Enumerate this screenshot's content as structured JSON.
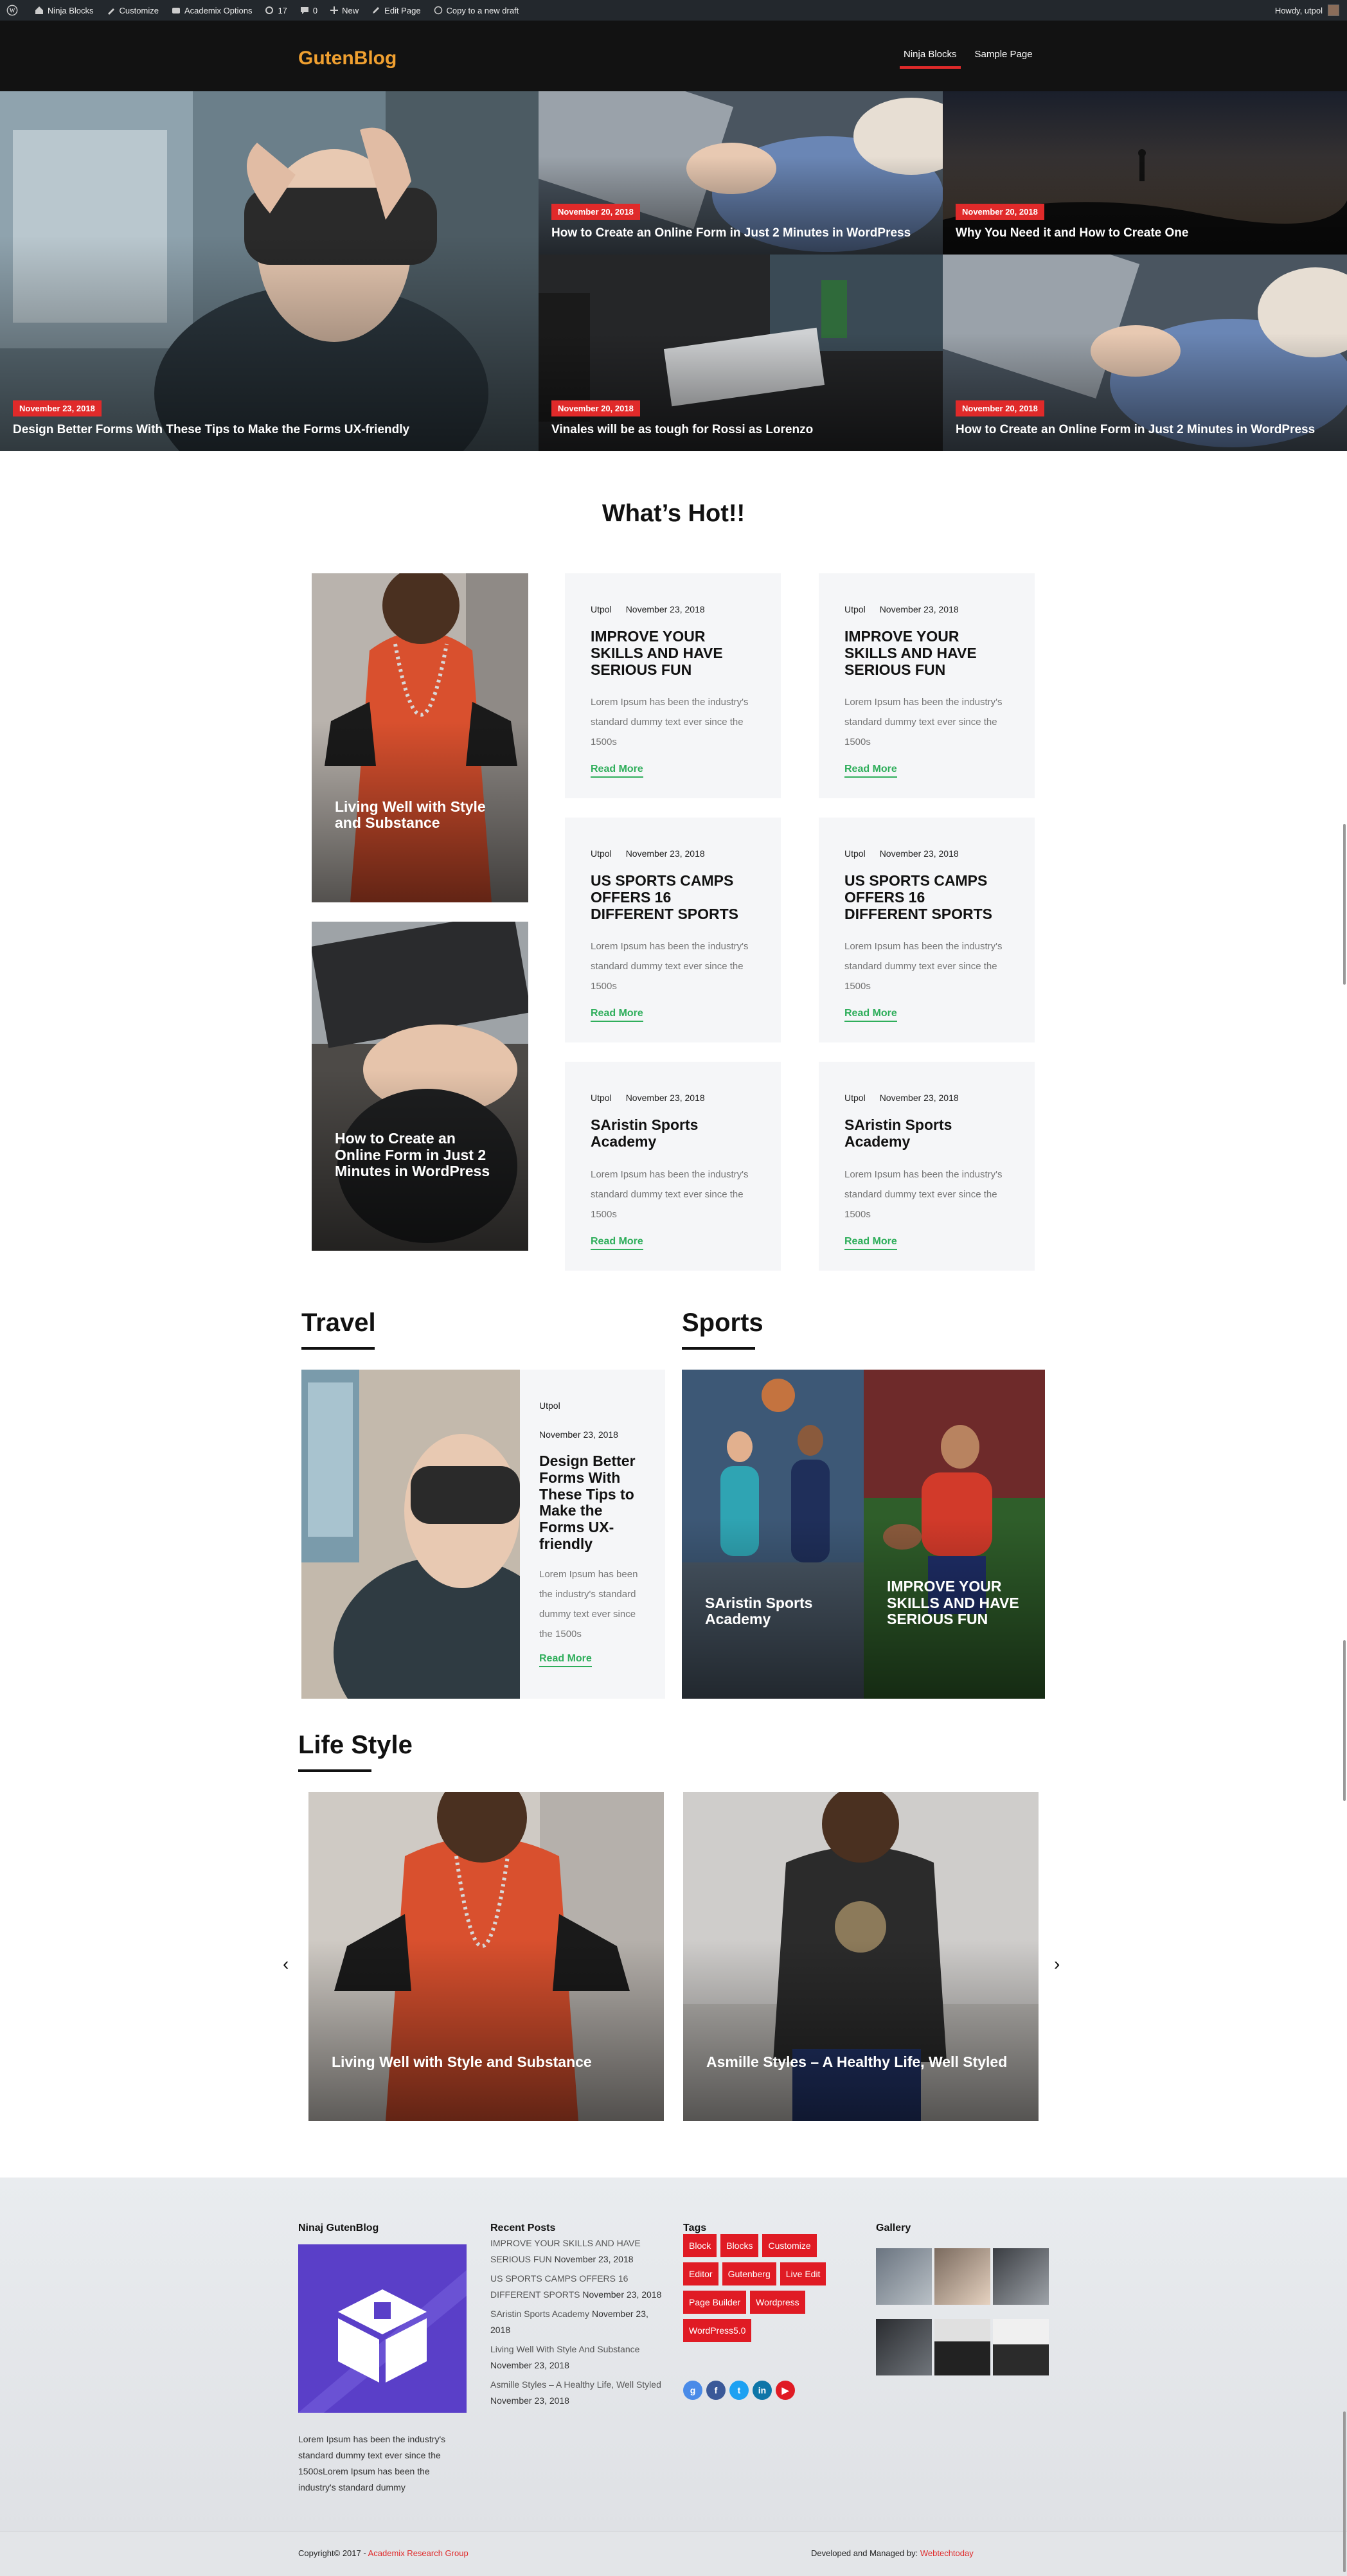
{
  "adminbar": {
    "site": "Ninja Blocks",
    "customize": "Customize",
    "academix": "Academix Options",
    "updates": "17",
    "comments": "0",
    "new": "New",
    "edit_page": "Edit Page",
    "copy_draft": "Copy to a new draft",
    "howdy": "Howdy, utpol"
  },
  "header": {
    "logo": "GutenBlog",
    "nav": [
      "Ninja Blocks",
      "Sample Page"
    ]
  },
  "hero": [
    {
      "date": "November 23, 2018",
      "title": "Design Better Forms With These Tips to Make the Forms UX-friendly"
    },
    {
      "date": "November 20, 2018",
      "title": "How to Create an Online Form in Just 2 Minutes in WordPress"
    },
    {
      "date": "November 20, 2018",
      "title": "Why You Need it and How to Create One"
    },
    {
      "date": "November 20, 2018",
      "title": "Vinales will be as tough for Rossi as Lorenzo"
    },
    {
      "date": "November 20, 2018",
      "title": "How to Create an Online Form in Just 2 Minutes in WordPress"
    }
  ],
  "whats_hot": {
    "heading": "What’s Hot!!",
    "image_cards": [
      {
        "title": "Living Well with Style and Substance"
      },
      {
        "title": "How to Create an Online Form in Just 2 Minutes in WordPress"
      }
    ],
    "posts": [
      {
        "author": "Utpol",
        "date": "November 23, 2018",
        "title": "IMPROVE YOUR SKILLS AND HAVE SERIOUS FUN",
        "excerpt": "Lorem Ipsum has been the industry's standard dummy text ever since the 1500s",
        "read_more": "Read More"
      },
      {
        "author": "Utpol",
        "date": "November 23, 2018",
        "title": "IMPROVE YOUR SKILLS AND HAVE SERIOUS FUN",
        "excerpt": "Lorem Ipsum has been the industry's standard dummy text ever since the 1500s",
        "read_more": "Read More"
      },
      {
        "author": "Utpol",
        "date": "November 23, 2018",
        "title": "US SPORTS CAMPS OFFERS 16 DIFFERENT SPORTS",
        "excerpt": "Lorem Ipsum has been the industry's standard dummy text ever since the 1500s",
        "read_more": "Read More"
      },
      {
        "author": "Utpol",
        "date": "November 23, 2018",
        "title": "US SPORTS CAMPS OFFERS 16 DIFFERENT SPORTS",
        "excerpt": "Lorem Ipsum has been the industry's standard dummy text ever since the 1500s",
        "read_more": "Read More"
      },
      {
        "author": "Utpol",
        "date": "November 23, 2018",
        "title": "SAristin Sports Academy",
        "excerpt": "Lorem Ipsum has been the industry's standard dummy text ever since the 1500s",
        "read_more": "Read More"
      },
      {
        "author": "Utpol",
        "date": "November 23, 2018",
        "title": "SAristin Sports Academy",
        "excerpt": "Lorem Ipsum has been the industry's standard dummy text ever since the 1500s",
        "read_more": "Read More"
      }
    ]
  },
  "travel": {
    "heading": "Travel",
    "author": "Utpol",
    "date": "November 23, 2018",
    "title": "Design Better Forms With These Tips to Make the Forms UX-friendly",
    "excerpt": "Lorem Ipsum has been the industry's standard dummy text ever since the 1500s",
    "read_more": "Read More"
  },
  "sports": {
    "heading": "Sports",
    "cards": [
      "SAristin Sports Academy",
      "IMPROVE YOUR SKILLS AND HAVE SERIOUS FUN"
    ]
  },
  "lifestyle": {
    "heading": "Life Style",
    "prev": "‹",
    "next": "›",
    "cards": [
      "Living Well with Style and Substance",
      "Asmille Styles – A Healthy Life, Well Styled"
    ]
  },
  "footer": {
    "about_heading": "Ninaj GutenBlog",
    "about_text": "Lorem Ipsum has been the industry's standard dummy text ever since the 1500sLorem Ipsum has been the industry's standard dummy",
    "recent_heading": "Recent Posts",
    "recent_posts": [
      {
        "title": "IMPROVE YOUR SKILLS AND HAVE SERIOUS FUN",
        "date": "November 23, 2018"
      },
      {
        "title": "US SPORTS CAMPS OFFERS 16 DIFFERENT SPORTS",
        "date": "November 23, 2018"
      },
      {
        "title": "SAristin Sports Academy",
        "date": "November 23, 2018"
      },
      {
        "title": "Living Well With Style And Substance",
        "date": "November 23, 2018"
      },
      {
        "title": "Asmille Styles – A Healthy Life, Well Styled",
        "date": "November 23, 2018"
      }
    ],
    "tags_heading": "Tags",
    "tags": [
      "Block",
      "Blocks",
      "Customize",
      "Editor",
      "Gutenberg",
      "Live Edit",
      "Page Builder",
      "Wordpress",
      "WordPress5.0"
    ],
    "social_icons": [
      "google-plus-icon",
      "facebook-icon",
      "twitter-icon",
      "linkedin-icon",
      "youtube-icon"
    ],
    "gallery_heading": "Gallery",
    "copyright_prefix": "Copyright© 2017 -",
    "copyright_link": "Academix Research Group",
    "developed_prefix": "Developed and Managed by:",
    "developed_link": "Webtechtoday"
  },
  "colors": {
    "accent_red": "#e02a2a",
    "logo_orange": "#f0a030",
    "read_more_green": "#2fae5b",
    "tag_red": "#e01b24"
  }
}
